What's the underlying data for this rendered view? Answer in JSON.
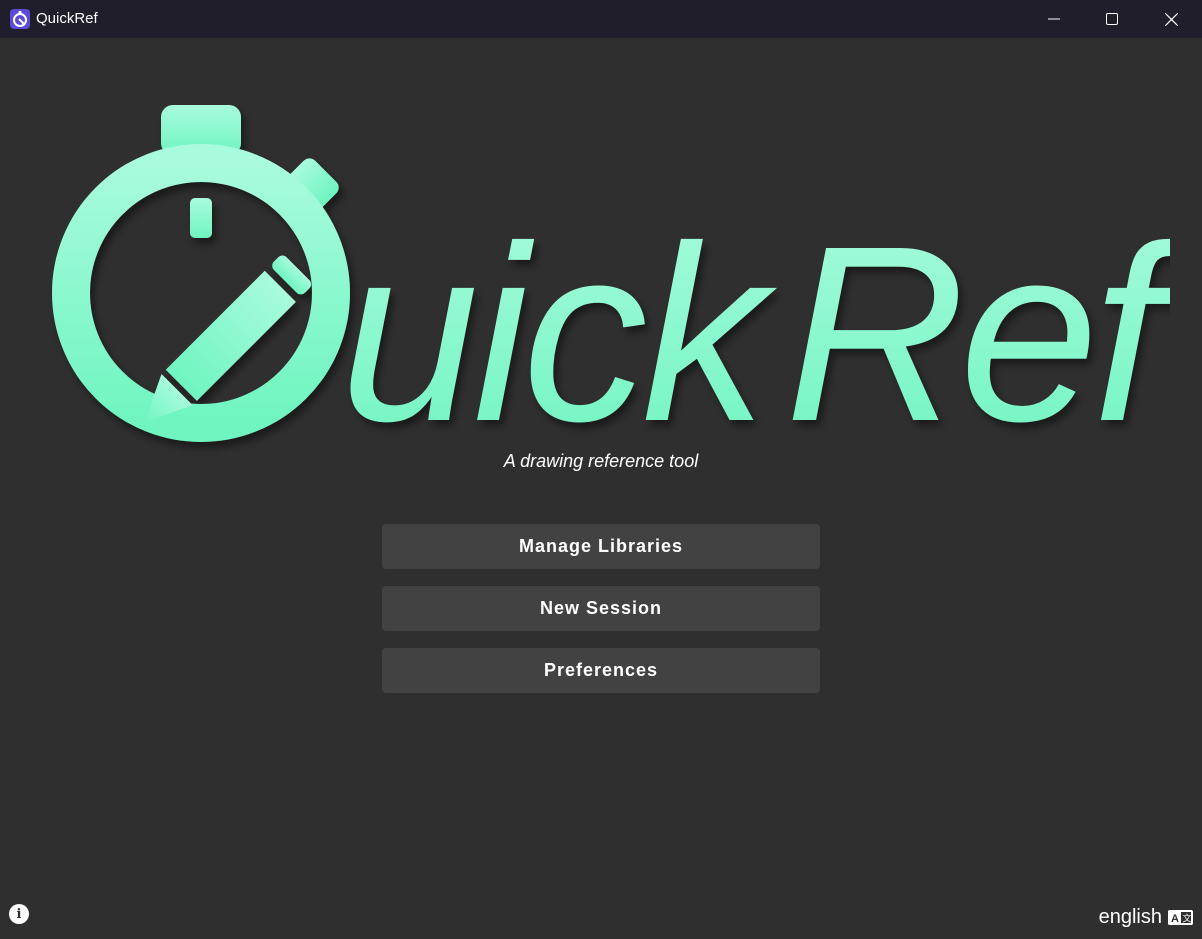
{
  "window": {
    "title": "QuickRef",
    "controls": [
      "minimize",
      "maximize",
      "close"
    ]
  },
  "logo": {
    "text_left": "uick",
    "text_right": "Ref",
    "color": "#7ff5c6"
  },
  "tagline": "A drawing reference tool",
  "menu": {
    "manage_libraries": "Manage Libraries",
    "new_session": "New Session",
    "preferences": "Preferences"
  },
  "footer": {
    "info_icon": "info-icon",
    "language": "english",
    "language_icon": "translate-icon"
  },
  "colors": {
    "background": "#2f2f2f",
    "titlebar": "#1f1e2a",
    "button": "#424242",
    "accent": "#7ff5c6"
  }
}
